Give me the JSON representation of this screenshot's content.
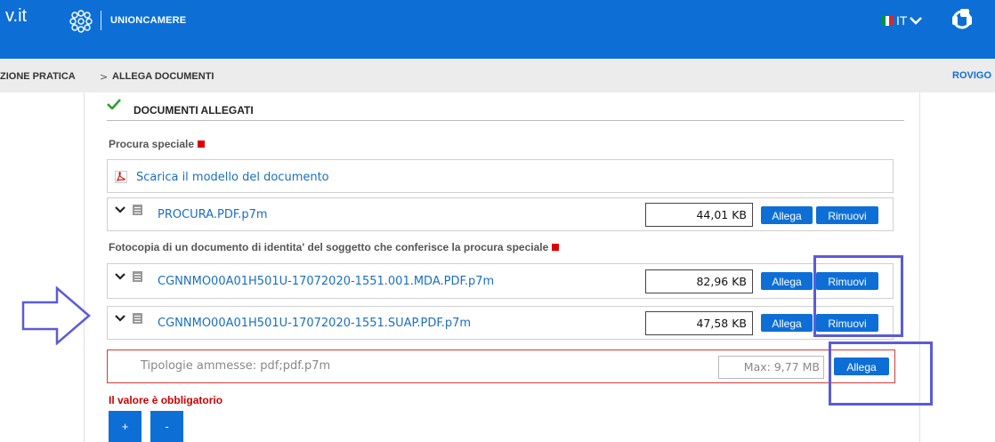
{
  "header": {
    "brand_fragment": "v.it",
    "org": "UNIONCAMERE",
    "lang": "IT",
    "lang_flag_colors": [
      "#009246",
      "#ffffff",
      "#ce2b37"
    ],
    "icons": [
      "unioncamere-logo-icon",
      "chevron-down-icon",
      "help-headset-icon"
    ]
  },
  "breadcrumb": {
    "items": [
      "ZIONE PRATICA",
      "ALLEGA DOCUMENTI"
    ],
    "separator": ">",
    "right": "ROVIGO"
  },
  "section": {
    "title": "DOCUMENTI ALLEGATI",
    "check_icon": "check-icon"
  },
  "groups": [
    {
      "label": "Procura speciale",
      "template_link": "Scarica il modello del documento",
      "files": [
        {
          "name": "PROCURA.PDF.p7m",
          "size": "44,01 KB",
          "attach": "Allega",
          "remove": "Rimuovi"
        }
      ]
    },
    {
      "label": "Fotocopia di un documento di identita' del soggetto che conferisce la procura speciale",
      "files": [
        {
          "name": "CGNNMO00A01H501U-17072020-1551.001.MDA.PDF.p7m",
          "size": "82,96 KB",
          "attach": "Allega",
          "remove": "Rimuovi"
        },
        {
          "name": "CGNNMO00A01H501U-17072020-1551.SUAP.PDF.p7m",
          "size": "47,58 KB",
          "attach": "Allega",
          "remove": "Rimuovi"
        }
      ]
    }
  ],
  "upload": {
    "placeholder": "Tipologie ammesse: pdf;pdf.p7m",
    "max": "Max: 9,77 MB",
    "attach": "Allega"
  },
  "error": "Il valore è obbligatorio",
  "controls": {
    "add": "+",
    "remove": "-"
  },
  "colors": {
    "primary": "#0d6fd6",
    "error": "#cc0000",
    "annotation": "#5b5bd6",
    "success": "#2ea02e"
  }
}
